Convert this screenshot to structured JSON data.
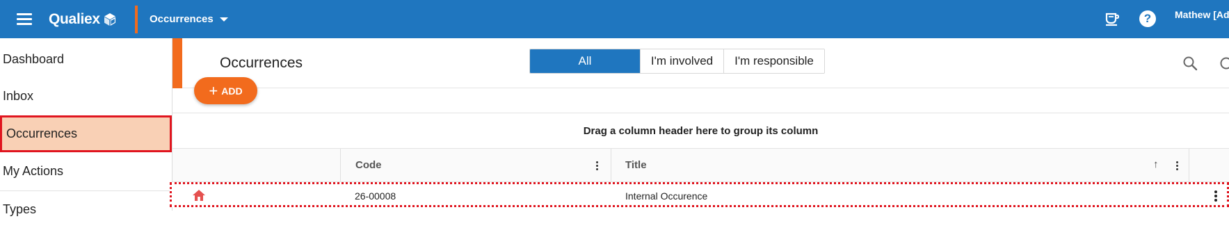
{
  "topbar": {
    "logo_text": "Qualiex",
    "module": "Occurrences",
    "user": "Mathew [Admin]",
    "icons": [
      "menu-icon",
      "logo-cube-icon",
      "chevron-down-icon",
      "coffee-cup-icon",
      "help-icon"
    ],
    "help_glyph": "?",
    "colors": {
      "bar": "#1f76bf",
      "accent": "#f26b1d"
    }
  },
  "sidebar": {
    "items": [
      {
        "label": "Dashboard"
      },
      {
        "label": "Inbox"
      },
      {
        "label": "Occurrences",
        "active": true
      },
      {
        "label": "My Actions"
      },
      {
        "label": "Types"
      }
    ]
  },
  "main": {
    "title": "Occurrences",
    "filters": [
      {
        "label": "All",
        "selected": true
      },
      {
        "label": "I'm involved"
      },
      {
        "label": "I'm responsible"
      }
    ],
    "add_button": {
      "icon": "plus",
      "label": "ADD"
    },
    "group_panel_text": "Drag a column header here to group its column",
    "grid": {
      "columns": [
        {
          "label": ""
        },
        {
          "label": "Code"
        },
        {
          "label": "Title",
          "sort": "ascending"
        }
      ],
      "sort_glyph": "↑",
      "rows": [
        {
          "icon": "home-icon",
          "code": "26-00008",
          "title": "Internal Occurence"
        }
      ]
    }
  }
}
